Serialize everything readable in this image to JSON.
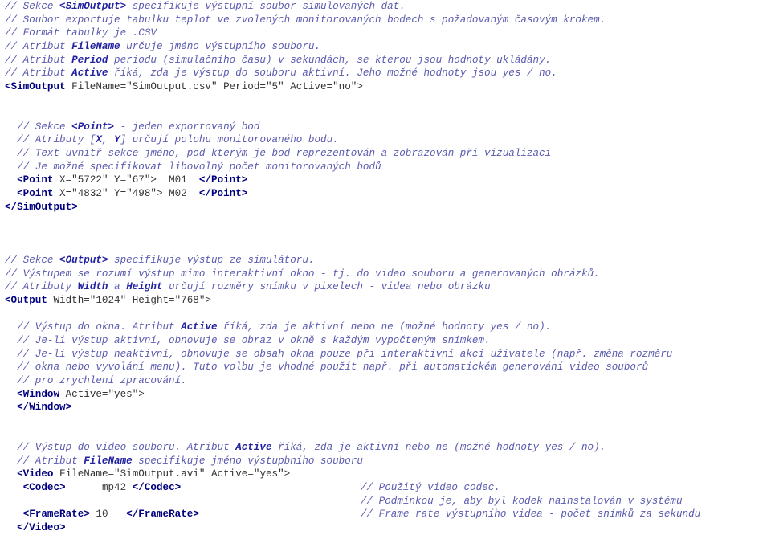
{
  "document": {
    "type": "xml-configuration-listing",
    "language": "cs",
    "colors": {
      "background": "#ffffff",
      "comment": "#5b5bb0",
      "comment_bold": "#2222a0",
      "tag": "#000080",
      "plain": "#333333"
    },
    "lines": [
      {
        "indent": "",
        "comment": "// Sekce ",
        "tagref": "<SimOutput>",
        "comment2": " specifikuje výstupní soubor simulovaných dat."
      },
      {
        "indent": "",
        "comment": "// Soubor exportuje tabulku teplot ve zvolených monitorovaných bodech s požadovaným časovým krokem."
      },
      {
        "indent": "",
        "comment": "// Formát tabulky je .CSV"
      },
      {
        "indent": "",
        "comment": "// Atribut ",
        "bold": "FileName",
        "comment2": " určuje jméno výstupního souboru."
      },
      {
        "indent": "",
        "comment": "// Atribut ",
        "bold": "Period",
        "comment2": " periodu (simulačního času) v sekundách, se kterou jsou hodnoty ukládány."
      },
      {
        "indent": "",
        "comment": "// Atribut ",
        "bold": "Active",
        "comment2": " říká, zda je výstup do souboru aktivní. Jeho možné hodnoty jsou yes / no."
      },
      {
        "indent": "",
        "tag_open": "<SimOutput",
        "attrs": " FileName=\"SimOutput.csv\" Period=\"5\" Active=\"no\">"
      },
      {
        "blank": true
      },
      {
        "blank": true
      },
      {
        "indent": "  ",
        "comment": "// Sekce ",
        "tagref": "<Point>",
        "comment2": " - jeden exportovaný bod"
      },
      {
        "indent": "  ",
        "comment": "// Atributy [",
        "bold": "X",
        "comment_mid": ", ",
        "bold2": "Y",
        "comment2": "] určují polohu monitorovaného bodu."
      },
      {
        "indent": "  ",
        "comment": "// Text uvnitř sekce jméno, pod kterým je bod reprezentován a zobrazován při vizualizaci"
      },
      {
        "indent": "  ",
        "comment": "// Je možné specifikovat libovolný počet monitorovaných bodů"
      },
      {
        "indent": "  ",
        "tag_open": "<Point",
        "attrs": " X=\"5722\" Y=\"67\"> ",
        "inner": " M01  ",
        "tag_close": "</Point>"
      },
      {
        "indent": "  ",
        "tag_open": "<Point",
        "attrs": " X=\"4832\" Y=\"498\"> ",
        "inner": "M02  ",
        "tag_close": "</Point>"
      },
      {
        "indent": "",
        "tag_close_only": "</SimOutput>"
      },
      {
        "blank": true
      },
      {
        "blank": true
      },
      {
        "blank": true
      },
      {
        "indent": "",
        "comment": "// Sekce ",
        "tagref": "<Output>",
        "comment2": " specifikuje výstup ze simulátoru."
      },
      {
        "indent": "",
        "comment": "// Výstupem se rozumí výstup mimo interaktivní okno - tj. do video souboru a generovaných obrázků."
      },
      {
        "indent": "",
        "comment": "// Atributy ",
        "bold": "Width",
        "comment_mid": " a ",
        "bold2": "Height",
        "comment2": " určují rozměry snímku v pixelech - videa nebo obrázku"
      },
      {
        "indent": "",
        "tag_open": "<Output",
        "attrs": " Width=\"1024\" Height=\"768\">"
      },
      {
        "blank": true
      },
      {
        "indent": "  ",
        "comment": "// Výstup do okna. Atribut ",
        "bold": "Active",
        "comment2": " říká, zda je aktivní nebo ne (možné hodnoty yes / no)."
      },
      {
        "indent": "  ",
        "comment": "// Je-li výstup aktivní, obnovuje se obraz v okně s každým vypočteným snímkem."
      },
      {
        "indent": "  ",
        "comment": "// Je-li výstup neaktivní, obnovuje se obsah okna pouze při interaktivní akci uživatele (např. změna rozměru"
      },
      {
        "indent": "  ",
        "comment": "// okna nebo vyvolání menu). Tuto volbu je vhodné použít např. při automatickém generování video souborů"
      },
      {
        "indent": "  ",
        "comment": "// pro zrychlení zpracování."
      },
      {
        "indent": "  ",
        "tag_open": "<Window",
        "attrs": " Active=\"yes\">"
      },
      {
        "indent": "  ",
        "tag_close_only": "</Window>"
      },
      {
        "blank": true
      },
      {
        "blank": true
      },
      {
        "indent": "  ",
        "comment": "// Výstup do video souboru. Atribut ",
        "bold": "Active",
        "comment2": " říká, zda je aktivní nebo ne (možné hodnoty yes / no)."
      },
      {
        "indent": "  ",
        "comment": "// Atribut ",
        "bold": "FileName",
        "comment2": " specifikuje jméno výstupbního souboru"
      },
      {
        "indent": "  ",
        "tag_open": "<Video",
        "attrs": " FileName=\"SimOutput.avi\" Active=\"yes\">"
      },
      {
        "indent": "   ",
        "tag_open": "<Codec>",
        "inner": "      mp42 ",
        "tag_close": "</Codec>",
        "tail": "// Použitý video codec."
      },
      {
        "blank": true,
        "tail": "// Podmínkou je, aby byl kodek nainstalován v systému"
      },
      {
        "indent": "   ",
        "tag_open": "<FrameRate>",
        "inner": " 10   ",
        "tag_close": "</FrameRate>",
        "tail": "// Frame rate výstupního videa - počet snímků za sekundu"
      },
      {
        "indent": "  ",
        "tag_close_only": "</Video>"
      }
    ]
  }
}
